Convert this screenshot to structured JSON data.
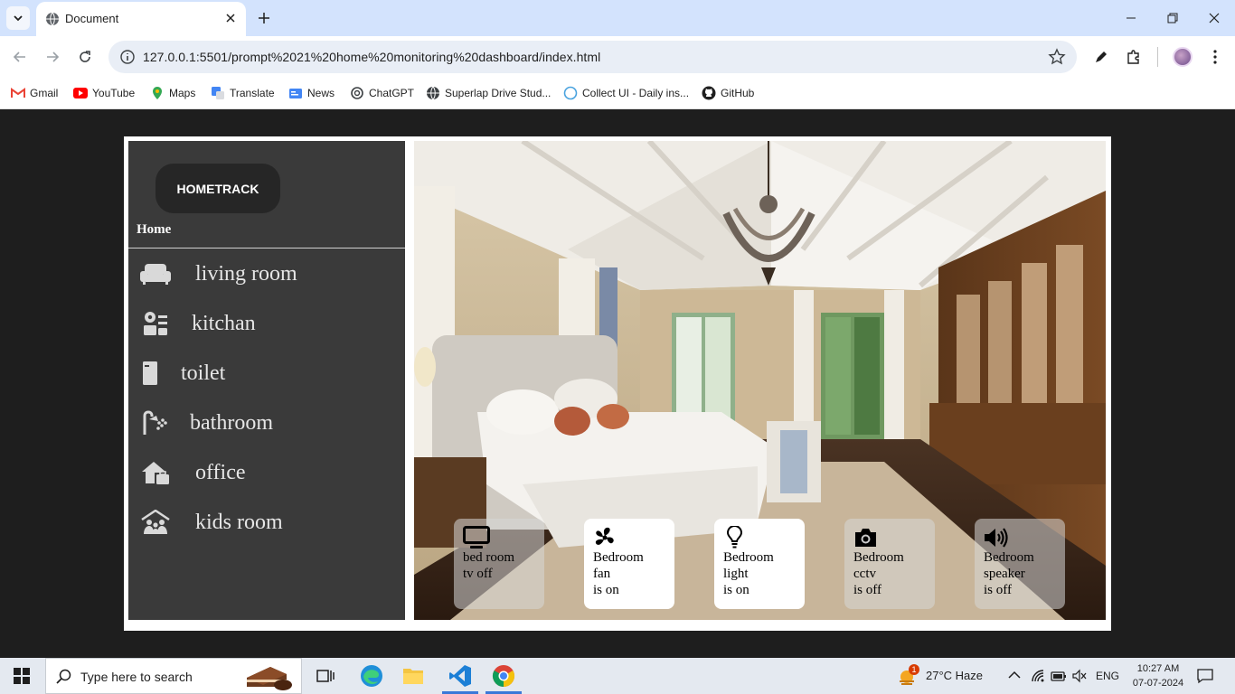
{
  "browser": {
    "tab_title": "Document",
    "url": "127.0.0.1:5501/prompt%2021%20home%20monitoring%20dashboard/index.html",
    "bookmarks": [
      {
        "label": "Gmail",
        "icon": "gmail-icon"
      },
      {
        "label": "YouTube",
        "icon": "youtube-icon"
      },
      {
        "label": "Maps",
        "icon": "maps-icon"
      },
      {
        "label": "Translate",
        "icon": "translate-icon"
      },
      {
        "label": "News",
        "icon": "news-icon"
      },
      {
        "label": "ChatGPT",
        "icon": "chatgpt-icon"
      },
      {
        "label": "Superlap Drive Stud...",
        "icon": "globe-icon"
      },
      {
        "label": "Collect UI - Daily ins...",
        "icon": "collectui-icon"
      },
      {
        "label": "GitHub",
        "icon": "github-icon"
      }
    ]
  },
  "sidebar": {
    "brand": "HOMETRACK",
    "home_label": "Home",
    "rooms": [
      {
        "label": "living room",
        "icon": "sofa-icon"
      },
      {
        "label": "kitchan",
        "icon": "kitchen-icon"
      },
      {
        "label": "toilet",
        "icon": "toilet-icon"
      },
      {
        "label": "bathroom",
        "icon": "shower-icon"
      },
      {
        "label": "office",
        "icon": "office-icon"
      },
      {
        "label": "kids room",
        "icon": "kids-icon"
      }
    ]
  },
  "devices": [
    {
      "line1": "bed room",
      "line2": "tv off",
      "line3": "",
      "state": "off",
      "icon": "tv-icon"
    },
    {
      "line1": "Bedroom",
      "line2": "fan",
      "line3": "is on",
      "state": "on",
      "icon": "fan-icon"
    },
    {
      "line1": "Bedroom",
      "line2": "light",
      "line3": "is on",
      "state": "on",
      "icon": "bulb-icon"
    },
    {
      "line1": "Bedroom",
      "line2": "cctv",
      "line3": "is off",
      "state": "off",
      "icon": "camera-icon"
    },
    {
      "line1": "Bedroom",
      "line2": "speaker",
      "line3": "is off",
      "state": "off",
      "icon": "speaker-icon"
    }
  ],
  "taskbar": {
    "search_placeholder": "Type here to search",
    "weather": "27°C  Haze",
    "weather_badge": "1",
    "language": "ENG",
    "time": "10:27 AM",
    "date": "07-07-2024"
  },
  "colors": {
    "page_background": "#1e1e1e",
    "sidebar": "#3a3a3a",
    "brand_pill": "#262626",
    "tabbar": "#d3e3fd"
  }
}
